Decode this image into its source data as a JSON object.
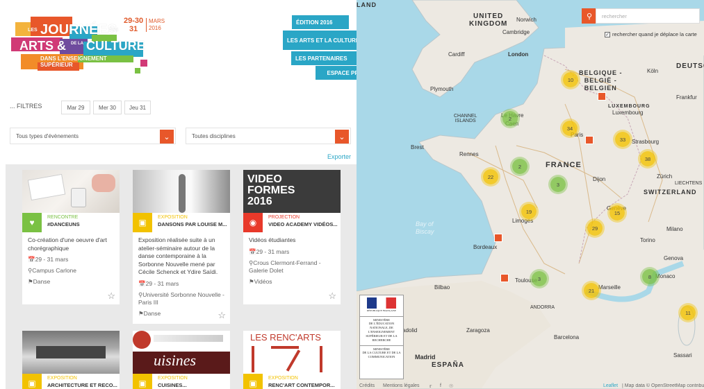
{
  "header": {
    "logo": {
      "les": "LES",
      "journees": "JOURNÉES",
      "des": "DES",
      "arts": "ARTS",
      "amp": "&",
      "de_la": "DE LA",
      "culture": "CULTURE",
      "sub1": "DANS L'ENSEIGNEMENT",
      "sub2": "SUPÉRIEUR"
    },
    "dates": "29-30\n31",
    "month": "MARS\n2016",
    "nav": [
      "ÉDITION 2016",
      "LES ARTS ET LA CULTURE DANS LE SUPÉRIEUR",
      "LES PARTENAIRES",
      "ESPACE PRESSE"
    ]
  },
  "filters": {
    "label": "... FILTRES",
    "dates": [
      "Mar 29",
      "Mer 30",
      "Jeu 31"
    ],
    "type_select": "Tous types d'évènements",
    "discipline_select": "Toutes disciplines",
    "export": "Exporter"
  },
  "cards": [
    {
      "category": "RENCONTRE",
      "title": "#DANCEUNS",
      "desc": "Co-création d'une oeuvre d'art chorégraphique",
      "date": "29 - 31 mars",
      "place": "Campus Carlone",
      "discipline": "Danse",
      "color": "#7ac143",
      "icon": "handshake-icon"
    },
    {
      "category": "EXPOSITION",
      "title": "DANSONS PAR LOUISE M...",
      "desc": "Exposition réalisée suite à un atelier-séminaire autour de la danse contemporaine à la Sorbonne Nouvelle mené par Cécile Schenck et Ydire Saïdi.",
      "date": "29 - 31 mars",
      "place": "Université Sorbonne Nouvelle - Paris III",
      "discipline": "Danse",
      "color": "#f2c200",
      "icon": "frame-icon"
    },
    {
      "category": "PROJECTION",
      "title": "VIDEO ACADEMY VIDÉOS...",
      "desc": "Vidéos étudiantes",
      "date": "29 - 31 mars",
      "place": "Crous Clermont-Ferrand - Galerie Dolet",
      "discipline": "Vidéos",
      "color": "#e8392a",
      "icon": "camera-icon",
      "img_text1": "VIDEO",
      "img_text2": "FORMES",
      "img_text3": "2016"
    },
    {
      "category": "EXPOSITION",
      "title": "ARCHITECTURE ET RECO...",
      "color": "#f2c200",
      "icon": "frame-icon"
    },
    {
      "category": "EXPOSITION",
      "title": "CUISINES...",
      "color": "#f2c200",
      "icon": "frame-icon",
      "img_text": "uisines"
    },
    {
      "category": "EXPOSITION",
      "title": "RENC'ART CONTEMPOR...",
      "color": "#f2c200",
      "icon": "frame-icon",
      "img_text": "LES RENC'ARTS"
    }
  ],
  "map": {
    "search_placeholder": "rechercher",
    "move_search": "rechercher quand je déplace la carte",
    "labels": {
      "uk": "UNITED\nKINGDOM",
      "france": "FRANCE",
      "belgique": "BELGIQUE -\nBELGIË -\nBELGIEN",
      "lux": "LUXEMBOURG",
      "luxc": "Luxembourg",
      "deutsch": "DEUTSC",
      "switz": "SWITZERLAND",
      "liechtens": "LIECHTENS",
      "espana": "ESPAÑA",
      "andorra": "ANDORRA",
      "channel": "CHANNEL\nISLANDS",
      "bay": "Bay of\nBiscay",
      "land": "LAND"
    },
    "cities": [
      "Norwich",
      "Cambridge",
      "London",
      "Cardiff",
      "Plymouth",
      "Köln",
      "Frankfur",
      "Le Havre",
      "Caen",
      "Paris",
      "Strasbourg",
      "Brest",
      "Rennes",
      "Dijon",
      "Zürich",
      "Genève",
      "Limoges",
      "Milano",
      "Bordeaux",
      "Torino",
      "Genova",
      "Toulouse",
      "Marseille",
      "Monaco",
      "Bilbao",
      "Zaragoza",
      "Barcelona",
      "Madrid",
      "Sassari",
      "adolid"
    ],
    "clusters": [
      "10",
      "2",
      "34",
      "33",
      "38",
      "2",
      "22",
      "3",
      "19",
      "15",
      "29",
      "3",
      "21",
      "8",
      "11"
    ],
    "ministry": {
      "m1": "MINISTÈRE",
      "m2": "DE L'ÉDUCATION NATIONALE, DE L'ENSEIGNEMENT SUPÉRIEUR ET DE LA RECHERCHE",
      "m3": "MINISTÈRE",
      "m4": "DE LA CULTURE ET DE LA COMMUNICATION",
      "rf": "RÉPUBLIQUE FRANÇAISE"
    },
    "footer": {
      "credits": "Crédits",
      "legal": "Mentions légales",
      "leaflet": "Leaflet",
      "mapdata": "| Map data © OpenStreetMap contributor"
    }
  },
  "colors": {
    "accent": "#e8572a",
    "nav": "#2aa6c6",
    "green": "#7ac143",
    "yellow": "#f2c200",
    "red": "#e8392a"
  }
}
